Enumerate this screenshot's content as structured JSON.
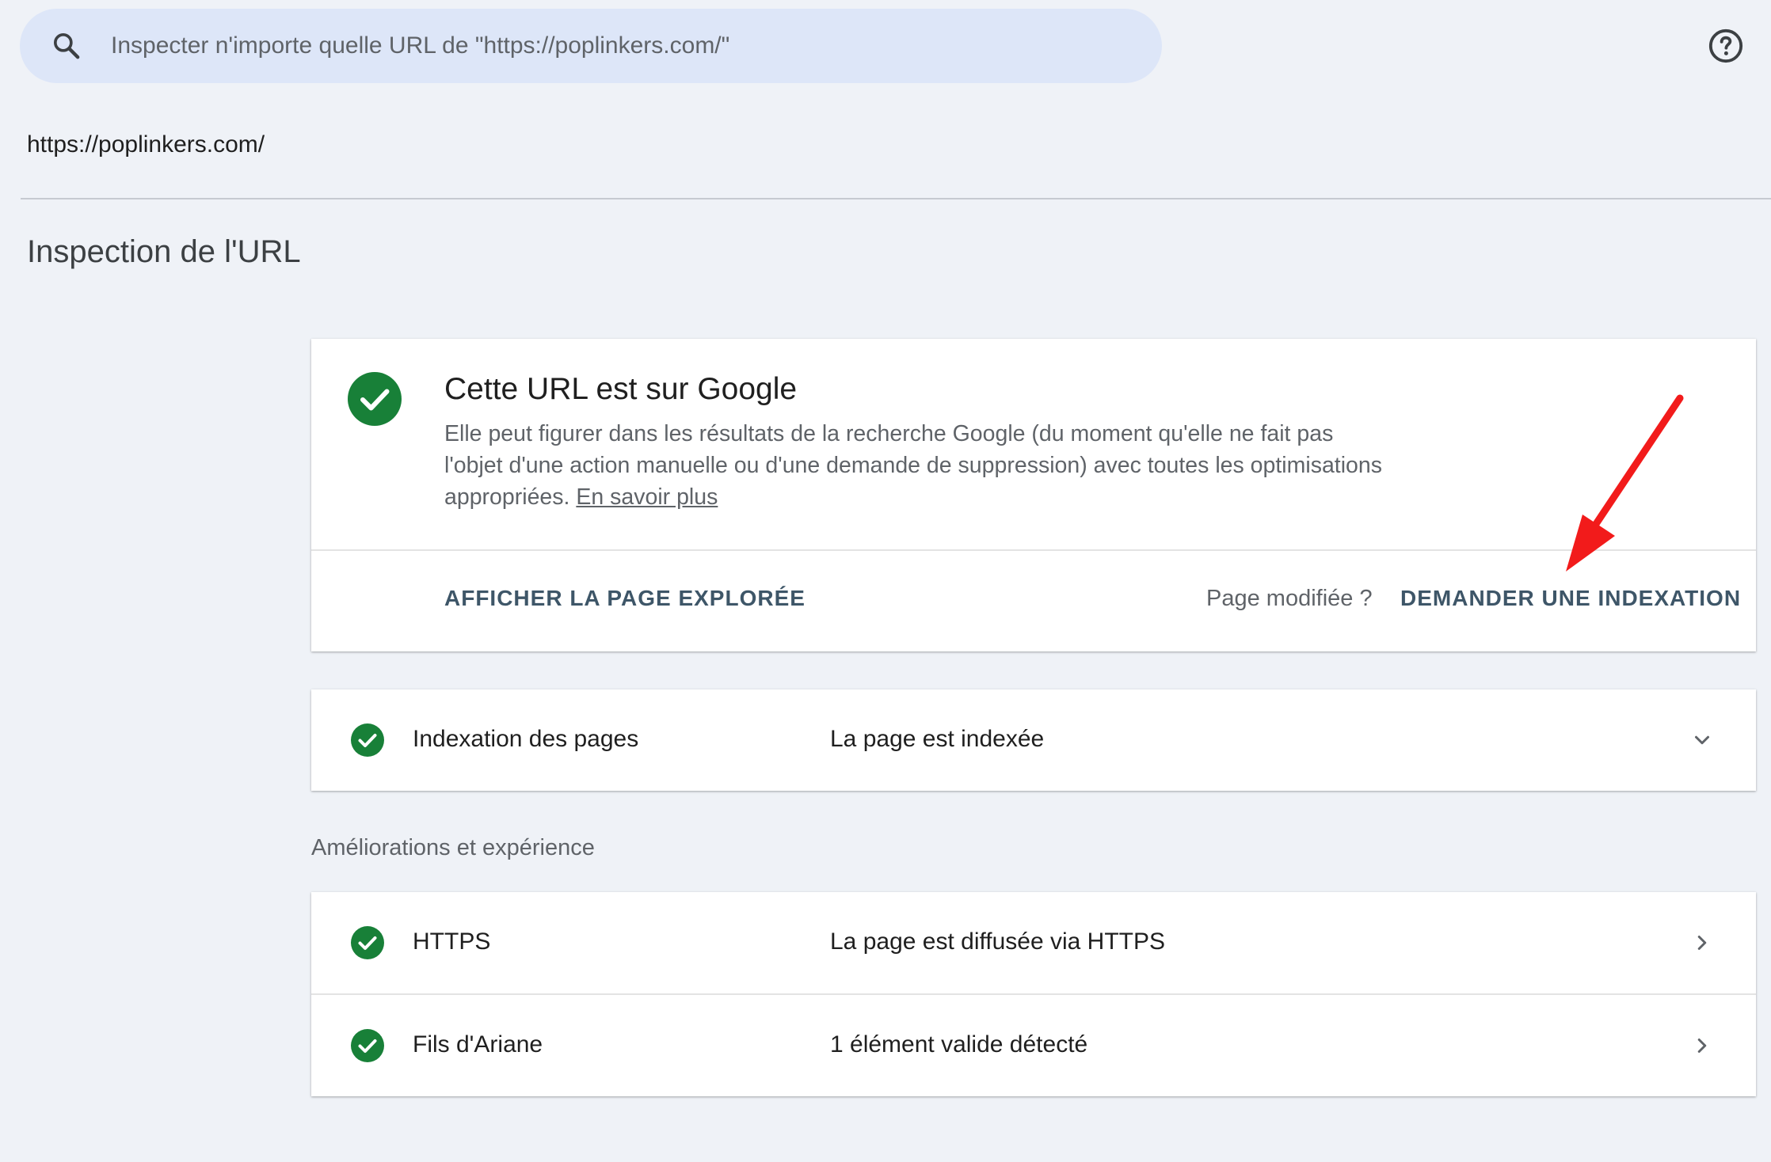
{
  "search": {
    "placeholder": "Inspecter n'importe quelle URL de \"https://poplinkers.com/\"",
    "icon": "search-icon"
  },
  "help": {
    "icon": "help-circle-icon"
  },
  "inspected_url": "https://poplinkers.com/",
  "page_title": "Inspection de l'URL",
  "status": {
    "icon": "check-circle-icon",
    "title": "Cette URL est sur Google",
    "description": "Elle peut figurer dans les résultats de la recherche Google (du moment qu'elle ne fait pas l'objet d'une action manuelle ou d'une demande de suppression) avec toutes les optimisations appropriées.",
    "learn_more": "En savoir plus",
    "view_page_label": "AFFICHER LA PAGE EXPLORÉE",
    "page_modified_label": "Page modifiée ?",
    "request_indexing_label": "DEMANDER UNE INDEXATION"
  },
  "indexing": {
    "label": "Indexation des pages",
    "value": "La page est indexée",
    "chevron": "chevron-down-icon"
  },
  "enhancements": {
    "section_label": "Améliorations et expérience",
    "rows": [
      {
        "label": "HTTPS",
        "value": "La page est diffusée via HTTPS",
        "chevron": "chevron-right-icon"
      },
      {
        "label": "Fils d'Ariane",
        "value": "1 élément valide détecté",
        "chevron": "chevron-right-icon"
      }
    ]
  },
  "colors": {
    "success_green": "#188038",
    "annotation_arrow": "#f21b1b",
    "action_text": "#3e5668"
  }
}
